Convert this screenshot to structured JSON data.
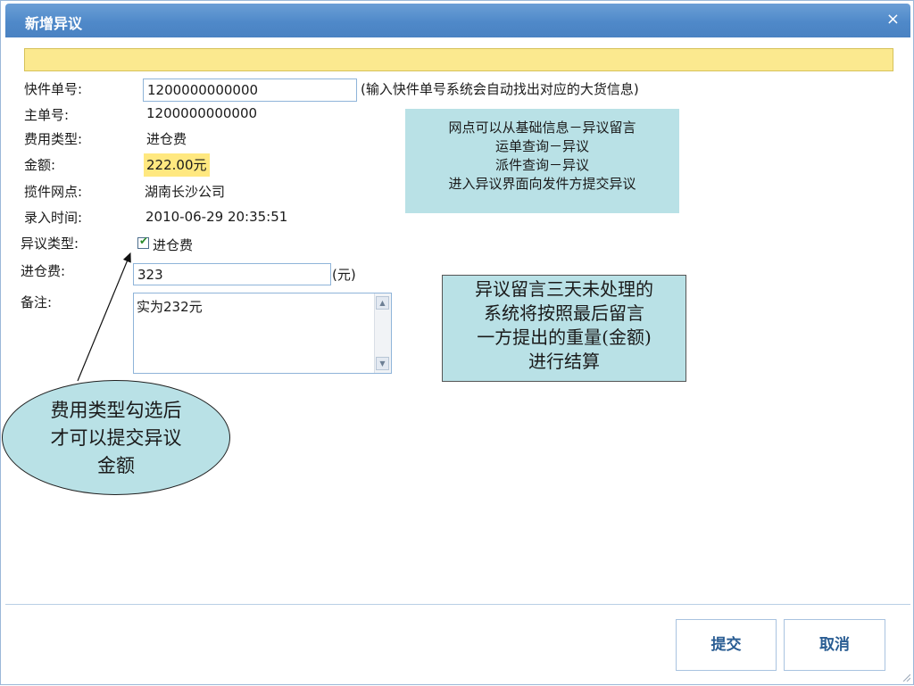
{
  "dialog": {
    "title": "新增异议",
    "close_label": "×"
  },
  "form": {
    "express_no_label": "快件单号:",
    "express_no_value": "1200000000000",
    "express_no_hint": "(输入快件单号系统会自动找出对应的大货信息)",
    "master_no_label": "主单号:",
    "master_no_value": "1200000000000",
    "fee_type_label": "费用类型:",
    "fee_type_value": "进仓费",
    "amount_label": "金额:",
    "amount_value": "222.00元",
    "pickup_site_label": "揽件网点:",
    "pickup_site_value": "湖南长沙公司",
    "entry_time_label": "录入时间:",
    "entry_time_value": "2010-06-29 20:35:51",
    "dispute_type_label": "异议类型:",
    "dispute_type_option": "进仓费",
    "dispute_type_checked": true,
    "warehouse_fee_label": "进仓费:",
    "warehouse_fee_value": "323",
    "warehouse_fee_unit": "(元)",
    "remark_label": "备注:",
    "remark_value": "实为232元"
  },
  "annotations": {
    "small_box_lines": [
      "网点可以从基础信息－异议留言",
      "运单查询－异议",
      "派件查询－异议",
      "进入异议界面向发件方提交异议"
    ],
    "big_box_lines": [
      "异议留言三天未处理的",
      "系统将按照最后留言",
      "一方提出的重量(金额)",
      "进行结算"
    ],
    "ellipse_lines": [
      "费用类型勾选后",
      "才可以提交异议",
      "金额"
    ]
  },
  "buttons": {
    "submit_label": "提交",
    "cancel_label": "取消"
  },
  "colors": {
    "titlebar": "#4f89c9",
    "notice_bar": "#fbe98f",
    "callout_fill": "#b9e1e6",
    "button_text": "#2a5d93"
  }
}
